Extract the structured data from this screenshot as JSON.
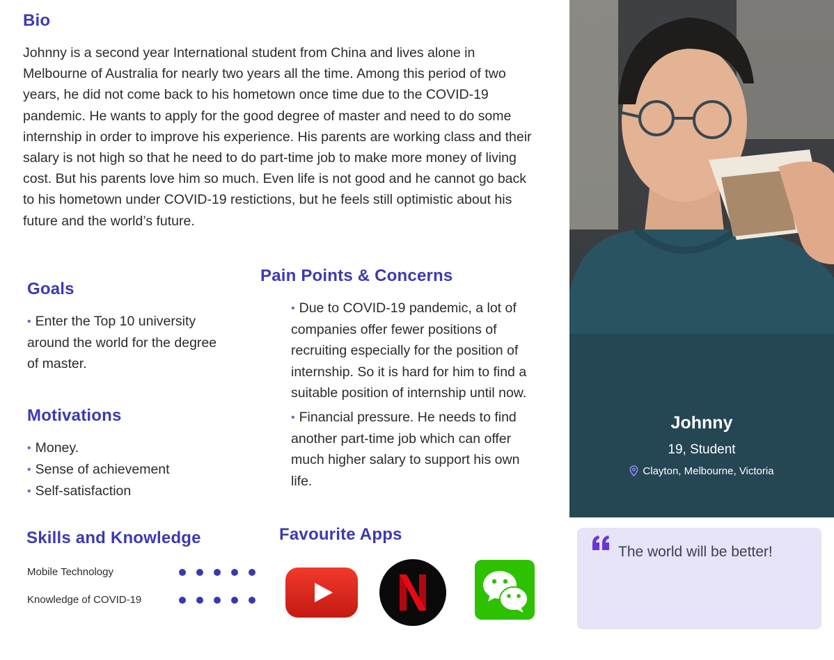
{
  "bio": {
    "heading": "Bio",
    "text": "Johnny is a second year International student from China and lives alone in Melbourne of Australia for nearly two years all the time. Among this period of two years, he did not come back to his hometown once time due to the COVID-19 pandemic. He wants to apply for the good degree of master and need to do some internship in order to improve his experience. His parents are working class and their salary is not high so that he need to do part-time job to make more money of living cost. But his parents love him so much. Even life is not good and he cannot go back to his hometown under COVID-19 restictions, but he feels still optimistic about his future and the world’s future."
  },
  "goals": {
    "heading": "Goals",
    "items": [
      "Enter the Top 10 university around the world for the degree of master."
    ]
  },
  "motivations": {
    "heading": "Motivations",
    "items": [
      "Money.",
      "Sense of achievement",
      "Self-satisfaction"
    ]
  },
  "pain_points": {
    "heading": "Pain Points & Concerns",
    "items": [
      "Due to COVID-19 pandemic, a lot of companies offer fewer positions of recruiting especially for the position of internship. So it is hard for him to find a suitable position of internship until now.",
      "Financial pressure. He needs to find another part-time job which can offer much higher salary to support his own life."
    ]
  },
  "skills": {
    "heading": "Skills and Knowledge",
    "items": [
      {
        "label": "Mobile Technology",
        "level": 5,
        "max": 5
      },
      {
        "label": "Knowledge of COVID-19",
        "level": 5,
        "max": 5
      }
    ]
  },
  "favourite_apps": {
    "heading": "Favourite Apps",
    "apps": [
      "youtube-icon",
      "netflix-icon",
      "wechat-icon"
    ]
  },
  "profile": {
    "name": "Johnny",
    "role": "19, Student",
    "location": "Clayton, Melbourne, Victoria"
  },
  "quote": {
    "text": "The world will be better!"
  },
  "colors": {
    "accent": "#3b3bb0",
    "quote_bg": "#e6e4f6",
    "quote_mark": "#6a35d6"
  }
}
